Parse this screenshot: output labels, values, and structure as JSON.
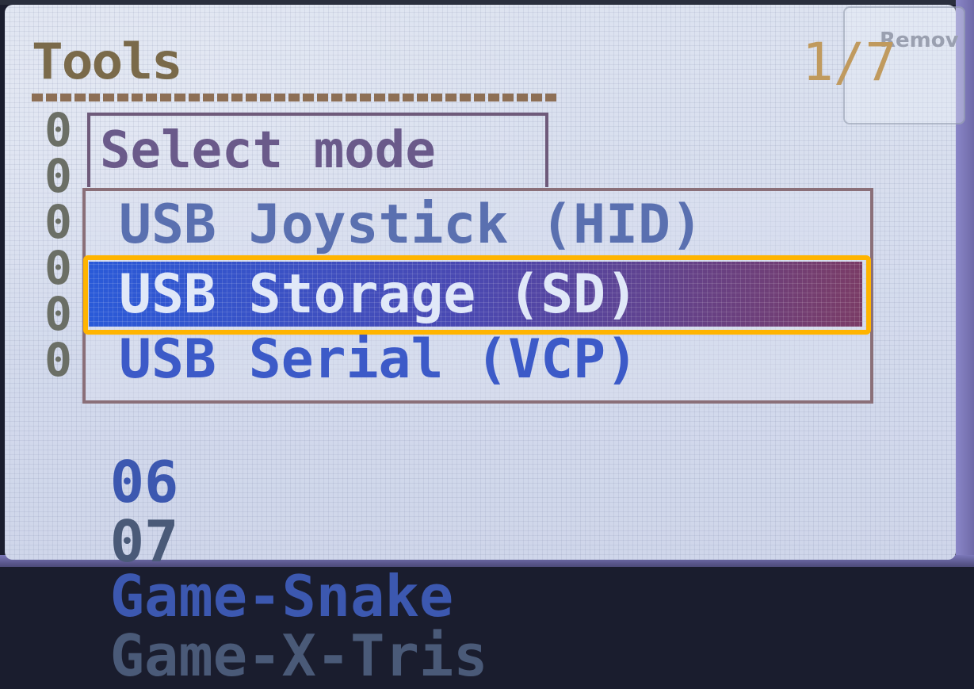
{
  "header": {
    "title": "Tools",
    "page_indicator": "1/7"
  },
  "sticker": {
    "text": "Remov"
  },
  "background_list": {
    "hidden_numbers": "0\n0\n0\n0\n0\n0",
    "items": [
      {
        "number": "06",
        "label": "Game-Snake"
      },
      {
        "number": "07",
        "label": "Game-X-Tris"
      }
    ]
  },
  "dialog": {
    "title": "Select mode",
    "options": [
      {
        "label": "USB Joystick (HID)",
        "selected": false
      },
      {
        "label": "USB Storage (SD)",
        "selected": true
      },
      {
        "label": "USB Serial (VCP)",
        "selected": false
      }
    ]
  },
  "colors": {
    "highlight_frame": "#ffb400",
    "selected_bar": "#2a5ad8"
  }
}
